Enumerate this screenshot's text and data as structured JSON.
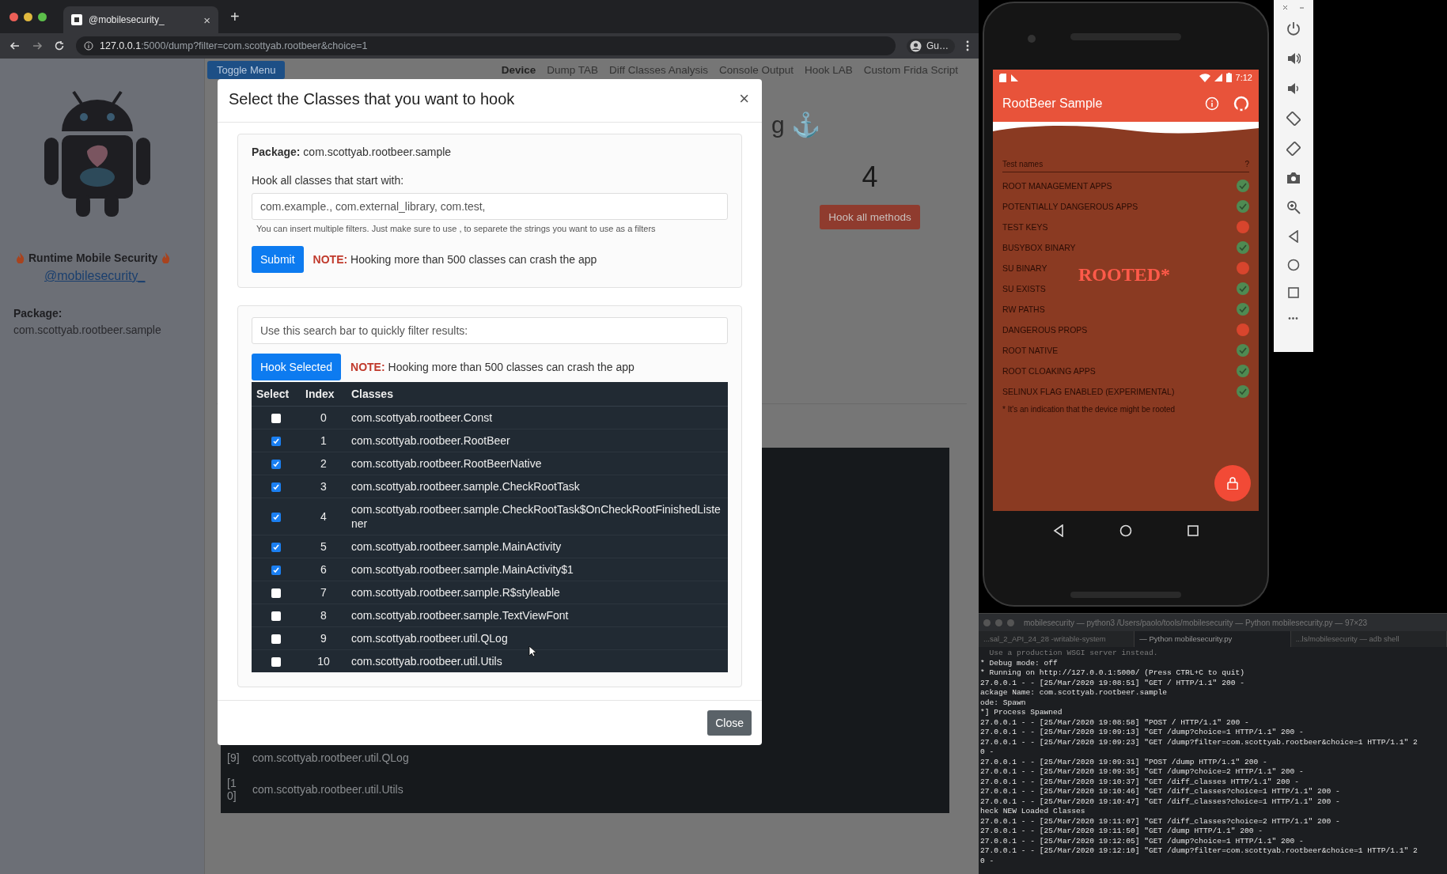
{
  "browser": {
    "tab": {
      "title": "@mobilesecurity_",
      "close": "×"
    },
    "new_tab": "+",
    "url_host": "127.0.0.1",
    "url_path": ":5000/dump?filter=com.scottyab.rootbeer&choice=1",
    "profile": "Gu…"
  },
  "sidebar": {
    "title": "Runtime Mobile Security",
    "handle": "@mobilesecurity_",
    "package_label": "Package:",
    "package": "com.scottyab.rootbeer.sample"
  },
  "page": {
    "toggle_button": "Toggle Menu",
    "nav": [
      {
        "label": "Device",
        "selected": true
      },
      {
        "label": "Dump TAB",
        "selected": false
      },
      {
        "label": "Diff Classes Analysis",
        "selected": false
      },
      {
        "label": "Console Output",
        "selected": false
      },
      {
        "label": "Hook LAB",
        "selected": false
      },
      {
        "label": "Custom Frida Script",
        "selected": false
      }
    ],
    "heading": "g ⚓",
    "count": "4",
    "hook_all_button": "Hook all methods",
    "output_rows": [
      {
        "index": "[9]",
        "class": "com.scottyab.rootbeer.util.QLog"
      },
      {
        "index": "[10]",
        "class": "com.scottyab.rootbeer.util.Utils"
      }
    ]
  },
  "modal": {
    "title": "Select the Classes that you want to hook",
    "close": "×",
    "package_label": "Package:",
    "package": "com.scottyab.rootbeer.sample",
    "filter_label": "Hook all classes that start with:",
    "filter_placeholder": "com.example., com.external_library, com.test,",
    "filter_help": "You can insert multiple filters. Just make sure to use , to separete the strings you want to use as a filters",
    "submit_button": "Submit",
    "note_label": "NOTE:",
    "note": "Hooking more than 500 classes can crash the app",
    "search_placeholder": "Use this search bar to quickly filter results:",
    "hook_selected_button": "Hook Selected",
    "note2_label": "NOTE:",
    "note2": "Hooking more than 500 classes can crash the app",
    "table": {
      "columns": [
        "Select",
        "Index",
        "Classes"
      ],
      "rows": [
        {
          "checked": false,
          "index": "0",
          "class": "com.scottyab.rootbeer.Const"
        },
        {
          "checked": true,
          "index": "1",
          "class": "com.scottyab.rootbeer.RootBeer"
        },
        {
          "checked": true,
          "index": "2",
          "class": "com.scottyab.rootbeer.RootBeerNative"
        },
        {
          "checked": true,
          "index": "3",
          "class": "com.scottyab.rootbeer.sample.CheckRootTask"
        },
        {
          "checked": true,
          "index": "4",
          "class": "com.scottyab.rootbeer.sample.CheckRootTask$OnCheckRootFinishedListener"
        },
        {
          "checked": true,
          "index": "5",
          "class": "com.scottyab.rootbeer.sample.MainActivity"
        },
        {
          "checked": true,
          "index": "6",
          "class": "com.scottyab.rootbeer.sample.MainActivity$1"
        },
        {
          "checked": false,
          "index": "7",
          "class": "com.scottyab.rootbeer.sample.R$styleable"
        },
        {
          "checked": false,
          "index": "8",
          "class": "com.scottyab.rootbeer.sample.TextViewFont"
        },
        {
          "checked": false,
          "index": "9",
          "class": "com.scottyab.rootbeer.util.QLog"
        },
        {
          "checked": false,
          "index": "10",
          "class": "com.scottyab.rootbeer.util.Utils"
        }
      ]
    },
    "close_button": "Close"
  },
  "phone": {
    "time": "7:12",
    "app_title": "RootBeer Sample",
    "list_header": "Test names",
    "list_header_hint": "?",
    "stamp": "ROOTED*",
    "tests": [
      {
        "name": "ROOT MANAGEMENT APPS",
        "passed": true
      },
      {
        "name": "POTENTIALLY DANGEROUS APPS",
        "passed": true
      },
      {
        "name": "TEST KEYS",
        "passed": false
      },
      {
        "name": "BUSYBOX BINARY",
        "passed": true
      },
      {
        "name": "SU BINARY",
        "passed": false
      },
      {
        "name": "SU EXISTS",
        "passed": true
      },
      {
        "name": "RW PATHS",
        "passed": true
      },
      {
        "name": "DANGEROUS PROPS",
        "passed": false
      },
      {
        "name": "ROOT NATIVE",
        "passed": true
      },
      {
        "name": "ROOT CLOAKING APPS",
        "passed": true
      },
      {
        "name": "SELINUX FLAG ENABLED (EXPERIMENTAL)",
        "passed": true
      }
    ],
    "footnote": "* It's an indication that the device might be rooted"
  },
  "emulator_toolbar": {
    "more": "•••"
  },
  "terminal": {
    "title": "mobilesecurity — python3 /Users/paolo/tools/mobilesecurity — Python mobilesecurity.py — 97×23",
    "tabs": [
      {
        "label": "...sal_2_API_24_28 -writable-system",
        "selected": false
      },
      {
        "label": "— Python mobilesecurity.py",
        "selected": true
      },
      {
        "label": "...ls/mobilesecurity — adb shell",
        "selected": false
      }
    ],
    "lines": [
      {
        "text": "  Use a production WSGI server instead.",
        "dim": true
      },
      {
        "text": "* Debug mode: off",
        "dim": false
      },
      {
        "text": "* Running on http://127.0.0.1:5000/ (Press CTRL+C to quit)",
        "dim": false
      },
      {
        "text": "27.0.0.1 - - [25/Mar/2020 19:08:51] \"GET / HTTP/1.1\" 200 -",
        "dim": false
      },
      {
        "text": "ackage Name: com.scottyab.rootbeer.sample",
        "dim": false
      },
      {
        "text": "ode: Spawn",
        "dim": false
      },
      {
        "text": "*] Process Spawned",
        "dim": false
      },
      {
        "text": "27.0.0.1 - - [25/Mar/2020 19:08:58] \"POST / HTTP/1.1\" 200 -",
        "dim": false
      },
      {
        "text": "27.0.0.1 - - [25/Mar/2020 19:09:13] \"GET /dump?choice=1 HTTP/1.1\" 200 -",
        "dim": false
      },
      {
        "text": "27.0.0.1 - - [25/Mar/2020 19:09:23] \"GET /dump?filter=com.scottyab.rootbeer&choice=1 HTTP/1.1\" 2",
        "dim": false
      },
      {
        "text": "0 -",
        "dim": false
      },
      {
        "text": "27.0.0.1 - - [25/Mar/2020 19:09:31] \"POST /dump HTTP/1.1\" 200 -",
        "dim": false
      },
      {
        "text": "27.0.0.1 - - [25/Mar/2020 19:09:35] \"GET /dump?choice=2 HTTP/1.1\" 200 -",
        "dim": false
      },
      {
        "text": "27.0.0.1 - - [25/Mar/2020 19:10:37] \"GET /diff_classes HTTP/1.1\" 200 -",
        "dim": false
      },
      {
        "text": "27.0.0.1 - - [25/Mar/2020 19:10:46] \"GET /diff_classes?choice=1 HTTP/1.1\" 200 -",
        "dim": false
      },
      {
        "text": "27.0.0.1 - - [25/Mar/2020 19:10:47] \"GET /diff_classes?choice=1 HTTP/1.1\" 200 -",
        "dim": false
      },
      {
        "text": "heck NEW Loaded Classes",
        "dim": false
      },
      {
        "text": "27.0.0.1 - - [25/Mar/2020 19:11:07] \"GET /diff_classes?choice=2 HTTP/1.1\" 200 -",
        "dim": false
      },
      {
        "text": "27.0.0.1 - - [25/Mar/2020 19:11:50] \"GET /dump HTTP/1.1\" 200 -",
        "dim": false
      },
      {
        "text": "27.0.0.1 - - [25/Mar/2020 19:12:05] \"GET /dump?choice=1 HTTP/1.1\" 200 -",
        "dim": false
      },
      {
        "text": "27.0.0.1 - - [25/Mar/2020 19:12:10] \"GET /dump?filter=com.scottyab.rootbeer&choice=1 HTTP/1.1\" 2",
        "dim": false
      },
      {
        "text": "0 -",
        "dim": false
      }
    ]
  }
}
